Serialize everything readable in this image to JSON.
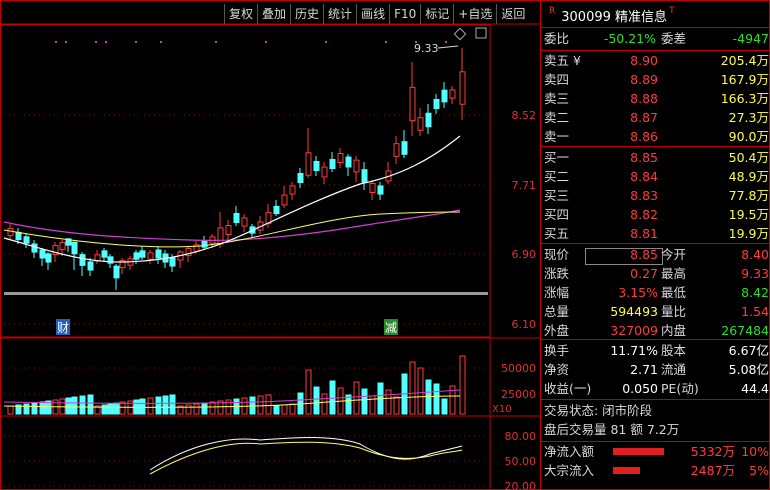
{
  "toolbar": [
    "复权",
    "叠加",
    "历史",
    "统计",
    "画线",
    "F10",
    "标记",
    "+自选",
    "返回"
  ],
  "chart": {
    "high_marker": "9.33",
    "price_axis": [
      "8.52",
      "7.71",
      "6.90",
      "6.10"
    ],
    "vol_axis": [
      "50000",
      "25000",
      "X10"
    ],
    "kdj_axis": [
      "80.00",
      "50.00",
      "20.00"
    ],
    "badges": [
      {
        "text": "财",
        "color": "#2060c0"
      },
      {
        "text": "减",
        "color": "#2a8a2a"
      }
    ]
  },
  "quote": {
    "code": "300099",
    "name": "精准信息",
    "webi": {
      "label": "委比",
      "value": "-50.21%",
      "label2": "委差",
      "value2": "-4947"
    },
    "asks": [
      {
        "label": "卖五",
        "mark": "¥",
        "price": "8.90",
        "vol": "205.4万"
      },
      {
        "label": "卖四",
        "price": "8.89",
        "vol": "167.9万"
      },
      {
        "label": "卖三",
        "price": "8.88",
        "vol": "166.3万"
      },
      {
        "label": "卖二",
        "price": "8.87",
        "vol": "27.3万"
      },
      {
        "label": "卖一",
        "price": "8.86",
        "vol": "90.0万"
      }
    ],
    "bids": [
      {
        "label": "买一",
        "price": "8.85",
        "vol": "50.4万"
      },
      {
        "label": "买二",
        "price": "8.84",
        "vol": "48.9万"
      },
      {
        "label": "买三",
        "price": "8.83",
        "vol": "77.8万"
      },
      {
        "label": "买四",
        "price": "8.82",
        "vol": "19.5万"
      },
      {
        "label": "买五",
        "price": "8.81",
        "vol": "19.9万"
      }
    ],
    "stats": [
      {
        "l1": "现价",
        "v1": "8.85",
        "l2": "今开",
        "v2": "8.40"
      },
      {
        "l1": "涨跌",
        "v1": "0.27",
        "l2": "最高",
        "v2": "9.33"
      },
      {
        "l1": "涨幅",
        "v1": "3.15%",
        "l2": "最低",
        "v2": "8.42"
      },
      {
        "l1": "总量",
        "v1": "594493",
        "l2": "量比",
        "v2": "1.54"
      },
      {
        "l1": "外盘",
        "v1": "327009",
        "l2": "内盘",
        "v2": "267484"
      }
    ],
    "stats2": [
      {
        "l1": "换手",
        "v1": "11.71%",
        "l2": "股本",
        "v2": "6.67亿"
      },
      {
        "l1": "净资",
        "v1": "2.71",
        "l2": "流通",
        "v2": "5.08亿"
      },
      {
        "l1": "收益(一)",
        "v1": "0.050",
        "l2": "PE(动)",
        "v2": "44.4"
      }
    ],
    "status": "交易状态: 闭市阶段",
    "after_hours": "盘后交易量 81 额 7.2万",
    "flows": [
      {
        "label": "净流入额",
        "value": "5332万",
        "pct": "10%",
        "bar": 0.95
      },
      {
        "label": "大宗流入",
        "value": "2487万",
        "pct": "5%",
        "bar": 0.5
      }
    ]
  },
  "colors": {
    "up": "#ff3b3b",
    "down": "#2adf2a",
    "vol_down": "#54ffff",
    "border": "#c00000"
  }
}
